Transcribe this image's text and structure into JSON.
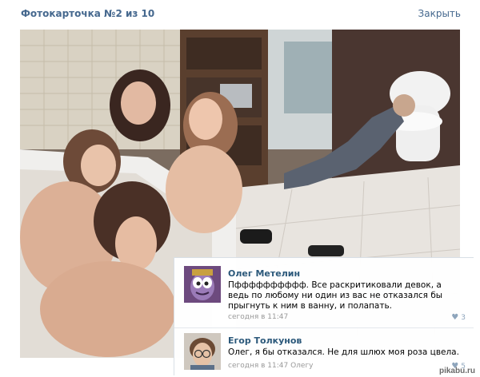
{
  "header": {
    "title": "Фотокарточка №2 из 10",
    "close_label": "Закрыть"
  },
  "comments": [
    {
      "author": "Олег Метелин",
      "text": "Пфффффффффф. Все раскритиковали девок, а ведь по любому ни один из вас не отказался бы прыгнуть к ним в ванну, и полапать.",
      "time": "сегодня в 11:47",
      "likes": "3"
    },
    {
      "author": "Егор Толкунов",
      "text": "Олег, я бы отказался. Не для шлюх моя роза цвела.",
      "time": "сегодня в 11:47 Олегу",
      "likes": "5"
    }
  ],
  "watermark": "pikabu.ru",
  "colors": {
    "link": "#45688e",
    "author": "#2b587a",
    "muted": "#999999"
  }
}
